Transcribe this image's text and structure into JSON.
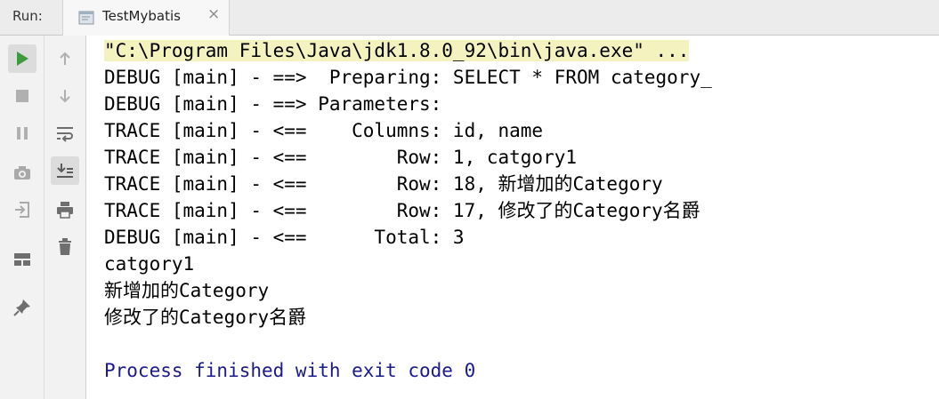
{
  "run_panel": {
    "label": "Run:",
    "tab": {
      "title": "TestMybatis",
      "close_glyph": "×"
    }
  },
  "left_toolbar": [
    {
      "icon": "play-icon",
      "active": true
    },
    {
      "icon": "stop-icon"
    },
    {
      "icon": "pause-icon"
    },
    {
      "icon": "camera-icon"
    },
    {
      "icon": "exit-icon"
    },
    {
      "icon": "layout-icon"
    },
    {
      "icon": "pin-icon"
    }
  ],
  "right_toolbar": [
    {
      "icon": "arrow-up-icon"
    },
    {
      "icon": "arrow-down-icon"
    },
    {
      "icon": "soft-wrap-icon"
    },
    {
      "icon": "scroll-to-end-icon",
      "active": true
    },
    {
      "icon": "print-icon"
    },
    {
      "icon": "trash-icon"
    }
  ],
  "console": {
    "command": "\"C:\\Program Files\\Java\\jdk1.8.0_92\\bin\\java.exe\" ...",
    "lines": [
      "DEBUG [main] - ==>  Preparing: SELECT * FROM category_ ",
      "DEBUG [main] - ==> Parameters: ",
      "TRACE [main] - <==    Columns: id, name",
      "TRACE [main] - <==        Row: 1, catgory1",
      "TRACE [main] - <==        Row: 18, 新增加的Category",
      "TRACE [main] - <==        Row: 17, 修改了的Category名爵",
      "DEBUG [main] - <==      Total: 3",
      "catgory1",
      "新增加的Category",
      "修改了的Category名爵",
      ""
    ],
    "finish": "Process finished with exit code 0"
  },
  "colors": {
    "finish_text": "#1a1a8c",
    "play_green": "#3d9a3d",
    "icon_gray": "#6e6e6e"
  }
}
